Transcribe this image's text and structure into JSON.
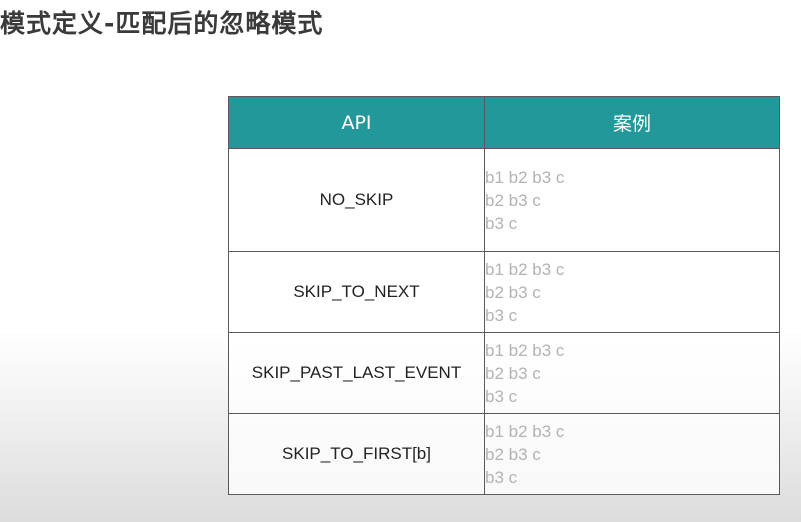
{
  "title": "模式定义-匹配后的忽略模式",
  "table": {
    "headers": [
      "API",
      "案例"
    ],
    "rows": [
      {
        "api": "NO_SKIP",
        "examples": [
          "b1 b2 b3 c",
          "b2 b3 c",
          "b3 c"
        ]
      },
      {
        "api": "SKIP_TO_NEXT",
        "examples": [
          "b1 b2 b3 c",
          "b2 b3 c",
          "b3 c"
        ]
      },
      {
        "api": "SKIP_PAST_LAST_EVENT",
        "examples": [
          "b1 b2 b3 c",
          "b2 b3 c",
          "b3 c"
        ]
      },
      {
        "api": "SKIP_TO_FIRST[b]",
        "examples": [
          "b1 b2 b3 c",
          "b2 b3 c",
          "b3 c"
        ]
      }
    ]
  },
  "colors": {
    "header_bg": "#22989b",
    "header_text": "#ffffff",
    "example_text": "#b3b3b3"
  }
}
